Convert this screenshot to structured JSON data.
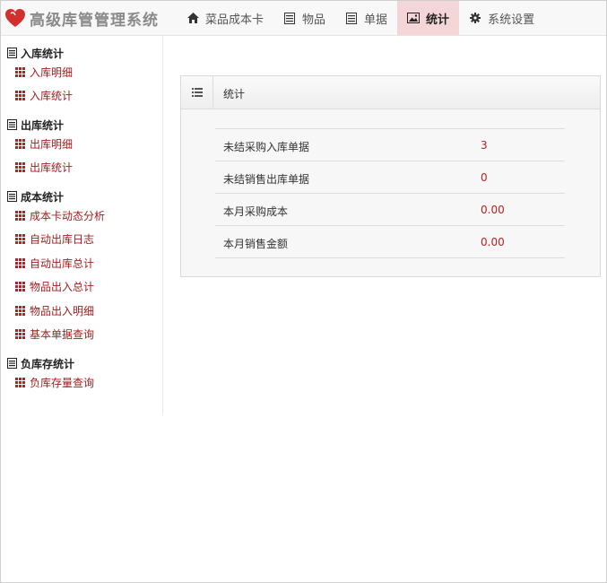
{
  "brand": {
    "text": "高级库管管理系统"
  },
  "nav": [
    {
      "label": "菜品成本卡",
      "icon": "home-icon"
    },
    {
      "label": "物品",
      "icon": "list-icon"
    },
    {
      "label": "单据",
      "icon": "list-icon"
    },
    {
      "label": "统计",
      "icon": "image-icon",
      "active": true
    },
    {
      "label": "系统设置",
      "icon": "gear-icon"
    }
  ],
  "sidebar": {
    "groups": [
      {
        "title": "入库统计",
        "items": [
          "入库明细",
          "入库统计"
        ]
      },
      {
        "title": "出库统计",
        "items": [
          "出库明细",
          "出库统计"
        ]
      },
      {
        "title": "成本统计",
        "items": [
          "成本卡动态分析",
          "自动出库日志",
          "自动出库总计",
          "物品出入总计",
          "物品出入明细",
          "基本单据查询"
        ]
      },
      {
        "title": "负库存统计",
        "items": [
          "负库存量查询"
        ]
      }
    ]
  },
  "panel": {
    "title": "统计",
    "rows": [
      {
        "label": "未结采购入库单据",
        "value": "3"
      },
      {
        "label": "未结销售出库单据",
        "value": "0"
      },
      {
        "label": "本月采购成本",
        "value": "0.00"
      },
      {
        "label": "本月销售金额",
        "value": "0.00"
      }
    ]
  },
  "colors": {
    "accent": "#b22222",
    "active_tab": "#f4d5d8",
    "brand_red": "#d32f2f"
  }
}
